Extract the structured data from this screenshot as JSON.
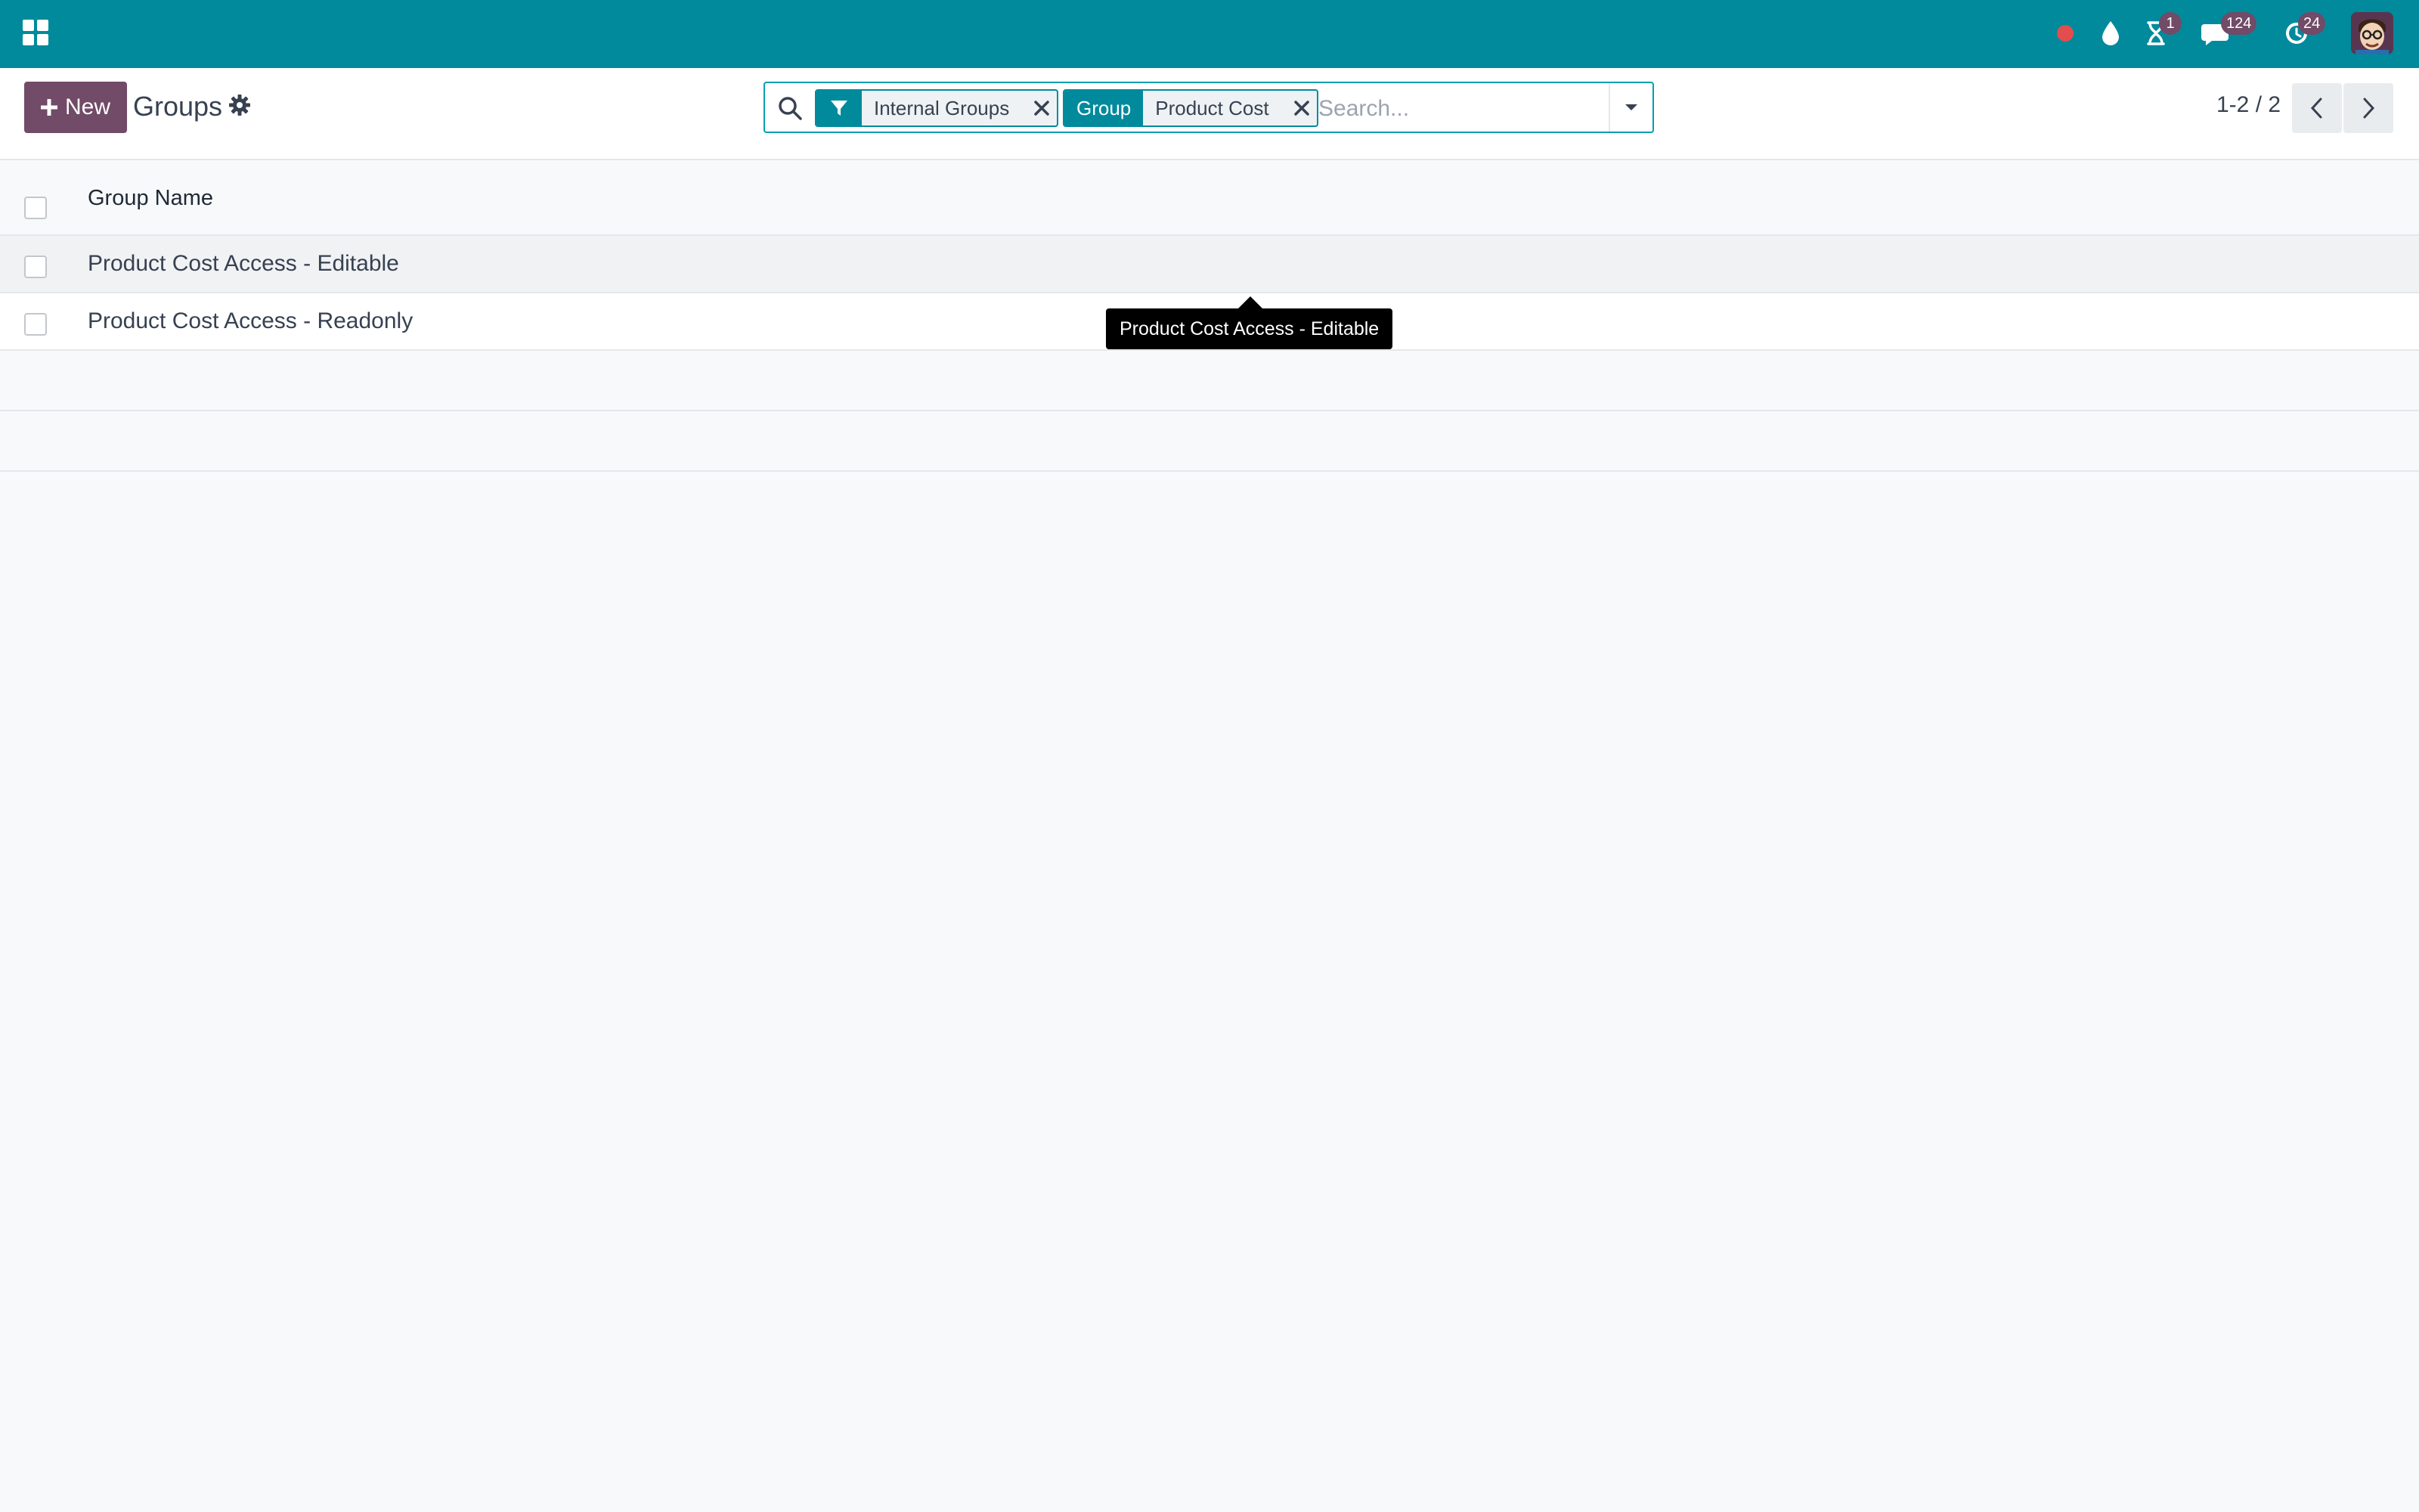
{
  "colors": {
    "navbar": "#008a9c",
    "brand": "#714b67",
    "accent": "#00a0b0",
    "status_dot": "#e44d4d"
  },
  "navbar": {
    "apps_icon": "apps-grid-icon",
    "status_icon": "red-dot-icon",
    "droplet_icon": "droplet-icon",
    "activities": {
      "icon": "hourglass-icon",
      "count": "1"
    },
    "messages": {
      "icon": "chat-icon",
      "count": "124"
    },
    "updates": {
      "icon": "refresh-clock-icon",
      "count": "24"
    },
    "avatar_icon": "user-avatar"
  },
  "control_panel": {
    "new_label": "New",
    "title": "Groups",
    "gear_icon": "gear-icon"
  },
  "search": {
    "facets": [
      {
        "tag_icon": "filter-icon",
        "value": "Internal Groups"
      },
      {
        "tag_label": "Group",
        "value": "Product Cost"
      }
    ],
    "placeholder": "Search..."
  },
  "pager": {
    "value": "1-2 / 2"
  },
  "list": {
    "column_header": "Group Name",
    "rows": [
      {
        "name": "Product Cost Access - Editable"
      },
      {
        "name": "Product Cost Access - Readonly"
      }
    ]
  },
  "tooltip": {
    "text": "Product Cost Access - Editable"
  }
}
